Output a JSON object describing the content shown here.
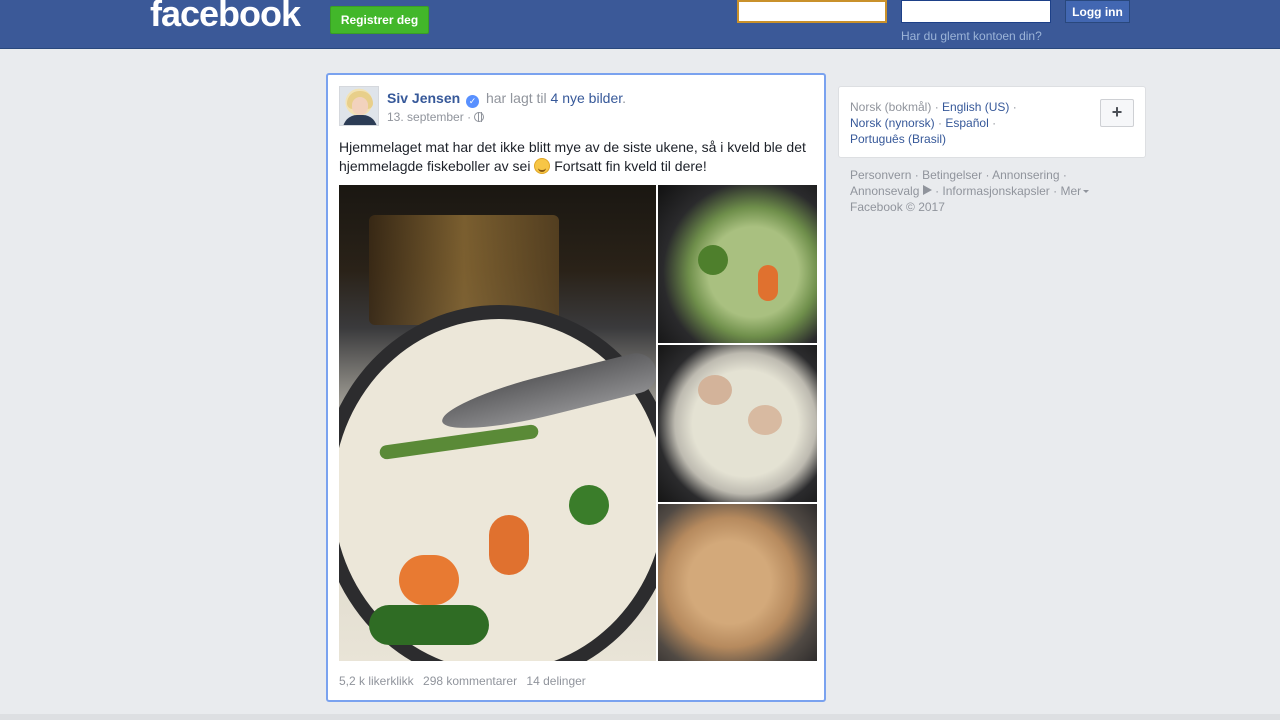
{
  "header": {
    "logo": "facebook",
    "register_label": "Registrer deg",
    "email_value": "",
    "password_value": "",
    "login_label": "Logg inn",
    "forgot_label": "Har du glemt kontoen din?"
  },
  "post": {
    "author": "Siv Jensen",
    "action_text": "har lagt til",
    "photos_link": "4 nye bilder",
    "period": ".",
    "date": "13. september",
    "separator": "·",
    "text_part1": "Hjemmelaget mat har det ikke blitt mye av de siste ukene, så i kveld ble det hjemmelagde fiskeboller av sei",
    "text_part2": "Fortsatt fin kveld til dere!",
    "likes": "5,2 k likerklikk",
    "comments": "298 kommentarer",
    "shares": "14 delinger"
  },
  "sidebar": {
    "languages": {
      "current": "Norsk (bokmål)",
      "lang1": "English (US)",
      "lang2": "Norsk (nynorsk)",
      "lang3": "Español",
      "lang4": "Português (Brasil)",
      "dot": "·"
    },
    "plus_label": "+"
  },
  "footer": {
    "privacy": "Personvern",
    "terms": "Betingelser",
    "advertising": "Annonsering",
    "ad_choices": "Annonsevalg",
    "cookies": "Informasjonskapsler",
    "more": "Mer",
    "copyright": "Facebook © 2017",
    "dot": "·"
  },
  "icons": {
    "verified": "verified-badge-icon",
    "globe": "globe-icon",
    "emoji": "smiling-emoji-icon",
    "adchoices": "adchoices-icon",
    "caret": "caret-down-icon"
  },
  "colors": {
    "topbar": "#3b5998",
    "register_green": "#42b72a",
    "link_blue": "#365899",
    "focus_border": "#7aa2ef"
  }
}
